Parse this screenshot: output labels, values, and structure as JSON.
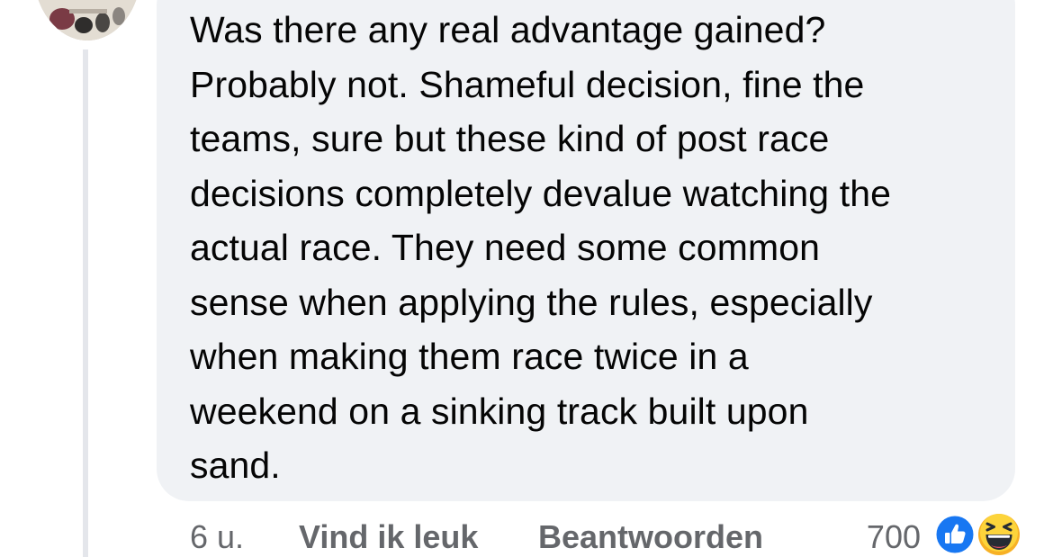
{
  "comment": {
    "text": "Was there any real advantage gained?\nProbably not. Shameful decision, fine the\nteams, sure but these kind of post race\ndecisions completely devalue watching the\nactual race. They need some common\nsense when applying the rules, especially\nwhen making them race twice in a\nweekend on a sinking track built upon\nsand."
  },
  "actions": {
    "time": "6 u.",
    "like_label": "Vind ik leuk",
    "reply_label": "Beantwoorden"
  },
  "reactions": {
    "count": "700",
    "icons": [
      "like-icon",
      "haha-icon"
    ]
  },
  "colors": {
    "bubble": "#f0f2f5",
    "text": "#050505",
    "secondary_text": "#65676b",
    "like_blue": "#1877f2",
    "haha_yellow": "#f7b125",
    "thread_line": "#e4e6eb"
  }
}
